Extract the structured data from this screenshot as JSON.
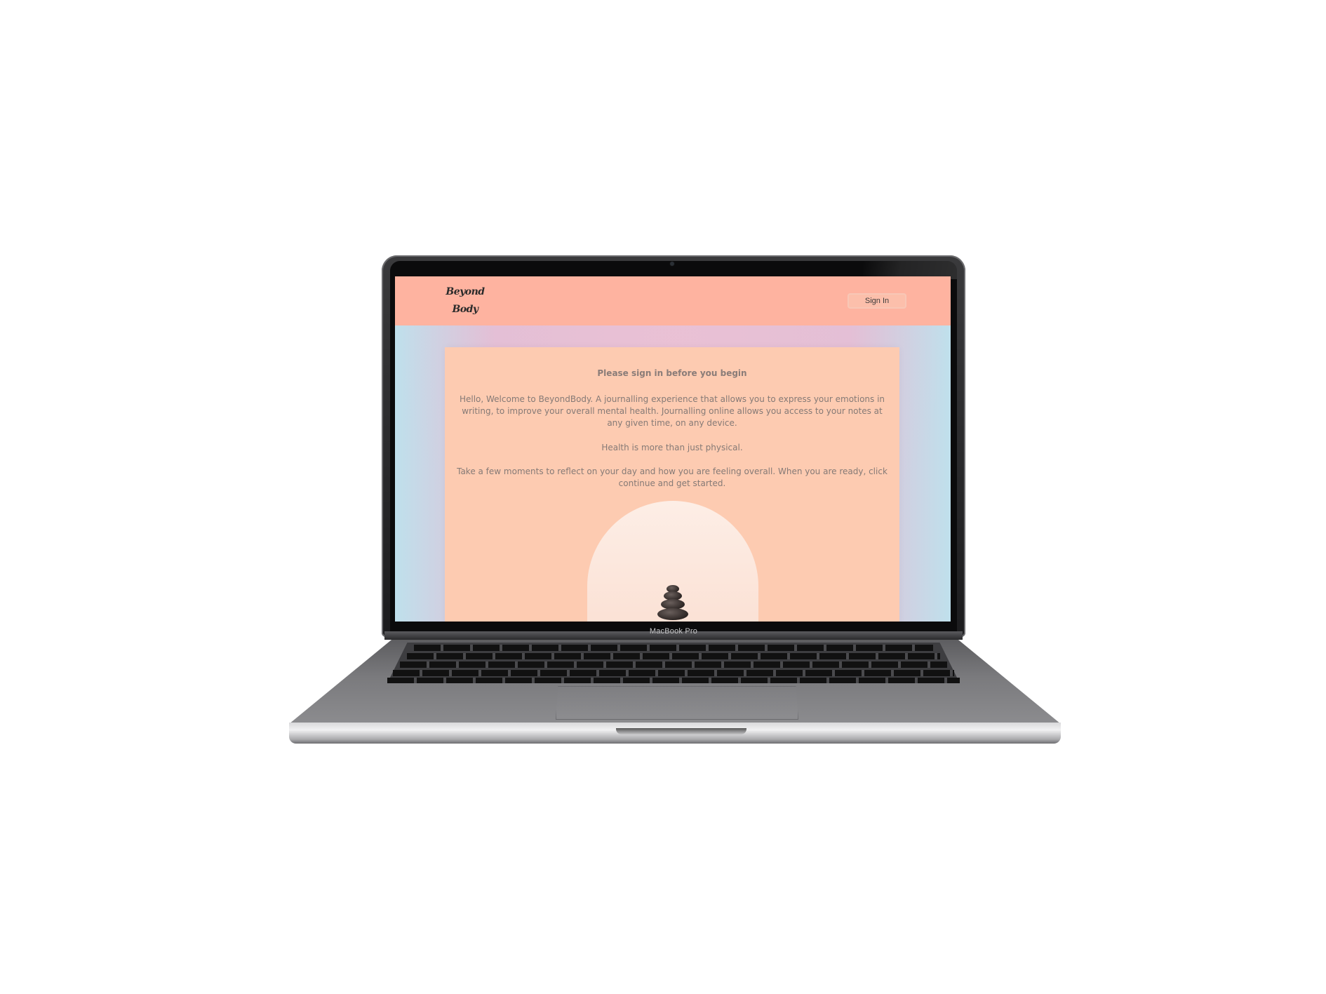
{
  "device": {
    "model_label": "MacBook Pro"
  },
  "site": {
    "logo_line1": "Beyond",
    "logo_line2": "Body",
    "signin_label": "Sign In",
    "header_color": "#feb3a0",
    "card_color": "#fdcbb1"
  },
  "card": {
    "heading": "Please sign in before you begin",
    "intro": "Hello, Welcome to BeyondBody. A journalling experience that allows you to express your emotions in writing, to improve your overall mental health. Journalling online allows you access to your notes at any given time, on any device.",
    "tagline": "Health is more than just physical.",
    "instruction": "Take a few moments to reflect on your day and how you are feeling overall. When you are ready, click continue and get started.",
    "image_icon": "stacked-stones-icon"
  }
}
